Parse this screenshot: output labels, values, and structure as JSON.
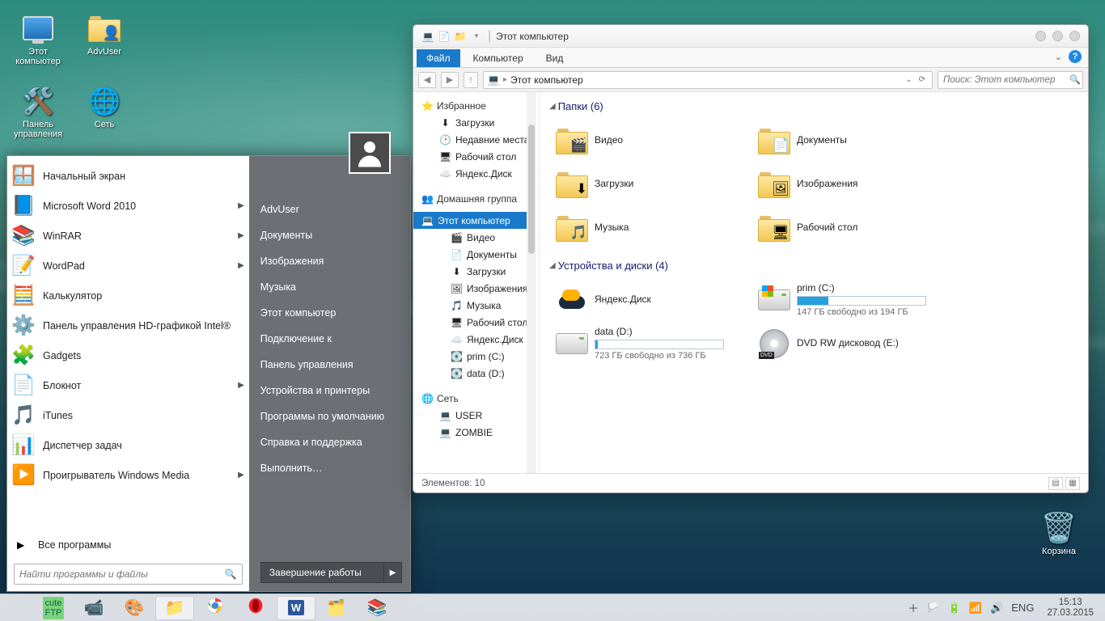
{
  "desktop": {
    "icons": [
      {
        "label": "Этот\nкомпьютер",
        "icon": "computer"
      },
      {
        "label": "AdvUser",
        "icon": "user-folder"
      },
      {
        "label": "Панель\nуправления",
        "icon": "control-panel"
      },
      {
        "label": "Сеть",
        "icon": "network"
      }
    ],
    "trash": "Корзина"
  },
  "start": {
    "apps": [
      {
        "label": "Начальный экран",
        "arrow": false
      },
      {
        "label": "Microsoft Word 2010",
        "arrow": true
      },
      {
        "label": "WinRAR",
        "arrow": true
      },
      {
        "label": "WordPad",
        "arrow": true
      },
      {
        "label": "Калькулятор",
        "arrow": false
      },
      {
        "label": "Панель управления HD-графикой Intel®",
        "arrow": false
      },
      {
        "label": "Gadgets",
        "arrow": false
      },
      {
        "label": "Блокнот",
        "arrow": true
      },
      {
        "label": "iTunes",
        "arrow": false
      },
      {
        "label": "Диспетчер задач",
        "arrow": false
      },
      {
        "label": "Проигрыватель Windows Media",
        "arrow": true
      }
    ],
    "all_programs": "Все программы",
    "search_placeholder": "Найти программы и файлы",
    "right": [
      "AdvUser",
      "Документы",
      "Изображения",
      "Музыка",
      "Этот компьютер",
      "Подключение к",
      "Панель управления",
      "Устройства и принтеры",
      "Программы по умолчанию",
      "Справка и поддержка",
      "Выполнить…"
    ],
    "shutdown": "Завершение работы"
  },
  "explorer": {
    "title": "Этот компьютер",
    "tabs": [
      "Файл",
      "Компьютер",
      "Вид"
    ],
    "breadcrumb": "Этот компьютер",
    "search_placeholder": "Поиск: Этот компьютер",
    "tree": {
      "favorites": "Избранное",
      "fav_items": [
        "Загрузки",
        "Недавние места",
        "Рабочий стол",
        "Яндекс.Диск"
      ],
      "homegroup": "Домашняя группа",
      "this_pc": "Этот компьютер",
      "pc_items": [
        "Видео",
        "Документы",
        "Загрузки",
        "Изображения",
        "Музыка",
        "Рабочий стол",
        "Яндекс.Диск",
        "prim (C:)",
        "data (D:)"
      ],
      "network": "Сеть",
      "net_items": [
        "USER",
        "ZOMBIE"
      ]
    },
    "group_folders": "Папки (6)",
    "folders": [
      {
        "label": "Видео",
        "badge": "🎬"
      },
      {
        "label": "Документы",
        "badge": "📄"
      },
      {
        "label": "Загрузки",
        "badge": "⬇"
      },
      {
        "label": "Изображения",
        "badge": "🖼"
      },
      {
        "label": "Музыка",
        "badge": "🎵"
      },
      {
        "label": "Рабочий стол",
        "badge": "🖥"
      }
    ],
    "group_devices": "Устройства и диски (4)",
    "devices": [
      {
        "label": "Яндекс.Диск",
        "kind": "cloud"
      },
      {
        "label": "prim (C:)",
        "kind": "drive-win",
        "free": "147 ГБ свободно из 194 ГБ",
        "pct": 24
      },
      {
        "label": "data (D:)",
        "kind": "drive",
        "free": "723 ГБ свободно из 736 ГБ",
        "pct": 2
      },
      {
        "label": "DVD RW дисковод (E:)",
        "kind": "dvd"
      }
    ],
    "status": "Элементов: 10"
  },
  "taskbar": {
    "lang": "ENG",
    "time": "15:13",
    "date": "27.03.2015"
  }
}
